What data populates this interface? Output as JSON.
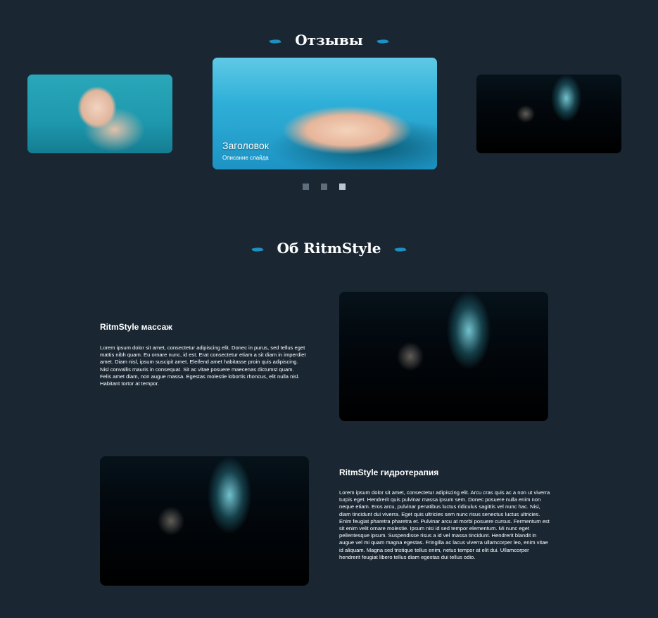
{
  "reviews": {
    "title": "Отзывы",
    "slides": [
      {
        "image": "baby-underwater-image"
      },
      {
        "image": "woman-floating-pool-image",
        "caption_title": "Заголовок",
        "caption_desc": "Описание слайда"
      },
      {
        "image": "diver-dark-water-image"
      }
    ],
    "dots": {
      "count": 3,
      "active_index": 2
    }
  },
  "about": {
    "title": "Об RitmStyle",
    "items": [
      {
        "heading": "RitmStyle массаж",
        "text": "Lorem ipsum dolor sit amet, consectetur adipiscing elit. Donec in purus, sed tellus eget mattis nibh quam. Eu ornare nunc, id est. Erat consectetur etiam a sit diam in imperdiet amet. Diam nisl, ipsum suscipit amet. Eleifend amet habitasse proin quis adipiscing. Nisl convallis mauris in consequat. Sit ac vitae posuere maecenas dictumst quam. Felis amet diam, non augue massa. Egestas molestie lobortis rhoncus, elit nulla nisl. Habitant tortor at tempor.",
        "image": "diver-dark-water-image"
      },
      {
        "heading": "RitmStyle гидротерапия",
        "text": "Lorem ipsum dolor sit amet, consectetur adipiscing elit. Arcu cras quis ac a non ut viverra turpis eget. Hendrerit quis pulvinar massa ipsum sem. Donec posuere nulla enim non neque etiam. Eros arcu, pulvinar penatibus luctus ridiculus sagittis vel nunc hac. Nisi, diam tincidunt dui viverra. Eget quis ultricies sem nunc risus senectus luctus ultricies. Enim feugiat pharetra pharetra et. Pulvinar arcu at morbi posuere cursus. Fermentum est sit enim velit ornare molestie. Ipsum nisi id sed tempor elementum. Mi nunc eget pellentesque ipsum. Suspendisse risus a id vel massa tincidunt. Hendrerit blandit in augue vel mi quam magna egestas. Fringilla ac lacus viverra ullamcorper leo, enim vitae id aliquam. Magna sed tristique tellus enim, netus tempor at elit dui. Ullamcorper hendrerit feugiat libero tellus diam egestas dui tellus odio.",
        "image": "diver-dark-water-image"
      }
    ]
  },
  "colors": {
    "background": "#1a2733",
    "accent": "#1e8fc0",
    "dot": "#5e6e7d",
    "dot_active": "#b9c7d3"
  }
}
